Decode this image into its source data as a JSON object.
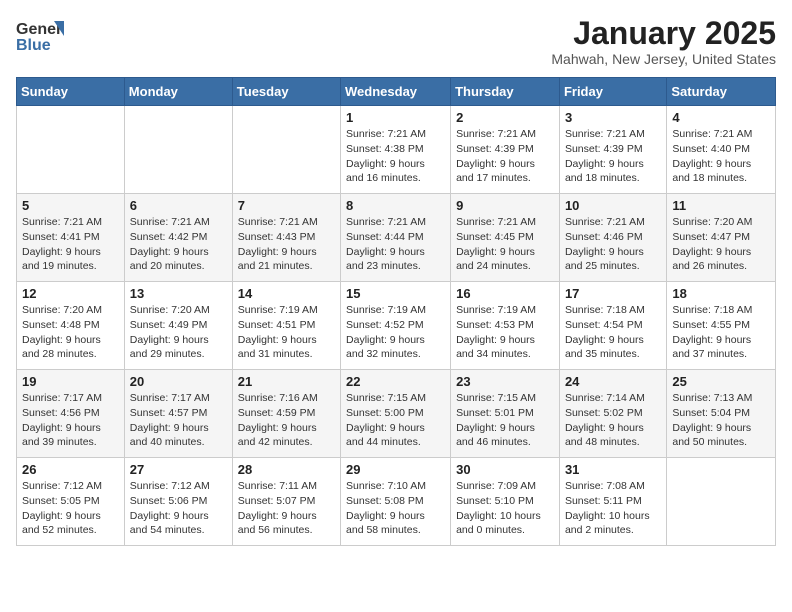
{
  "header": {
    "logo_general": "General",
    "logo_blue": "Blue",
    "month_title": "January 2025",
    "location": "Mahwah, New Jersey, United States"
  },
  "days_of_week": [
    "Sunday",
    "Monday",
    "Tuesday",
    "Wednesday",
    "Thursday",
    "Friday",
    "Saturday"
  ],
  "weeks": [
    [
      {
        "day": "",
        "info": ""
      },
      {
        "day": "",
        "info": ""
      },
      {
        "day": "",
        "info": ""
      },
      {
        "day": "1",
        "info": "Sunrise: 7:21 AM\nSunset: 4:38 PM\nDaylight: 9 hours\nand 16 minutes."
      },
      {
        "day": "2",
        "info": "Sunrise: 7:21 AM\nSunset: 4:39 PM\nDaylight: 9 hours\nand 17 minutes."
      },
      {
        "day": "3",
        "info": "Sunrise: 7:21 AM\nSunset: 4:39 PM\nDaylight: 9 hours\nand 18 minutes."
      },
      {
        "day": "4",
        "info": "Sunrise: 7:21 AM\nSunset: 4:40 PM\nDaylight: 9 hours\nand 18 minutes."
      }
    ],
    [
      {
        "day": "5",
        "info": "Sunrise: 7:21 AM\nSunset: 4:41 PM\nDaylight: 9 hours\nand 19 minutes."
      },
      {
        "day": "6",
        "info": "Sunrise: 7:21 AM\nSunset: 4:42 PM\nDaylight: 9 hours\nand 20 minutes."
      },
      {
        "day": "7",
        "info": "Sunrise: 7:21 AM\nSunset: 4:43 PM\nDaylight: 9 hours\nand 21 minutes."
      },
      {
        "day": "8",
        "info": "Sunrise: 7:21 AM\nSunset: 4:44 PM\nDaylight: 9 hours\nand 23 minutes."
      },
      {
        "day": "9",
        "info": "Sunrise: 7:21 AM\nSunset: 4:45 PM\nDaylight: 9 hours\nand 24 minutes."
      },
      {
        "day": "10",
        "info": "Sunrise: 7:21 AM\nSunset: 4:46 PM\nDaylight: 9 hours\nand 25 minutes."
      },
      {
        "day": "11",
        "info": "Sunrise: 7:20 AM\nSunset: 4:47 PM\nDaylight: 9 hours\nand 26 minutes."
      }
    ],
    [
      {
        "day": "12",
        "info": "Sunrise: 7:20 AM\nSunset: 4:48 PM\nDaylight: 9 hours\nand 28 minutes."
      },
      {
        "day": "13",
        "info": "Sunrise: 7:20 AM\nSunset: 4:49 PM\nDaylight: 9 hours\nand 29 minutes."
      },
      {
        "day": "14",
        "info": "Sunrise: 7:19 AM\nSunset: 4:51 PM\nDaylight: 9 hours\nand 31 minutes."
      },
      {
        "day": "15",
        "info": "Sunrise: 7:19 AM\nSunset: 4:52 PM\nDaylight: 9 hours\nand 32 minutes."
      },
      {
        "day": "16",
        "info": "Sunrise: 7:19 AM\nSunset: 4:53 PM\nDaylight: 9 hours\nand 34 minutes."
      },
      {
        "day": "17",
        "info": "Sunrise: 7:18 AM\nSunset: 4:54 PM\nDaylight: 9 hours\nand 35 minutes."
      },
      {
        "day": "18",
        "info": "Sunrise: 7:18 AM\nSunset: 4:55 PM\nDaylight: 9 hours\nand 37 minutes."
      }
    ],
    [
      {
        "day": "19",
        "info": "Sunrise: 7:17 AM\nSunset: 4:56 PM\nDaylight: 9 hours\nand 39 minutes."
      },
      {
        "day": "20",
        "info": "Sunrise: 7:17 AM\nSunset: 4:57 PM\nDaylight: 9 hours\nand 40 minutes."
      },
      {
        "day": "21",
        "info": "Sunrise: 7:16 AM\nSunset: 4:59 PM\nDaylight: 9 hours\nand 42 minutes."
      },
      {
        "day": "22",
        "info": "Sunrise: 7:15 AM\nSunset: 5:00 PM\nDaylight: 9 hours\nand 44 minutes."
      },
      {
        "day": "23",
        "info": "Sunrise: 7:15 AM\nSunset: 5:01 PM\nDaylight: 9 hours\nand 46 minutes."
      },
      {
        "day": "24",
        "info": "Sunrise: 7:14 AM\nSunset: 5:02 PM\nDaylight: 9 hours\nand 48 minutes."
      },
      {
        "day": "25",
        "info": "Sunrise: 7:13 AM\nSunset: 5:04 PM\nDaylight: 9 hours\nand 50 minutes."
      }
    ],
    [
      {
        "day": "26",
        "info": "Sunrise: 7:12 AM\nSunset: 5:05 PM\nDaylight: 9 hours\nand 52 minutes."
      },
      {
        "day": "27",
        "info": "Sunrise: 7:12 AM\nSunset: 5:06 PM\nDaylight: 9 hours\nand 54 minutes."
      },
      {
        "day": "28",
        "info": "Sunrise: 7:11 AM\nSunset: 5:07 PM\nDaylight: 9 hours\nand 56 minutes."
      },
      {
        "day": "29",
        "info": "Sunrise: 7:10 AM\nSunset: 5:08 PM\nDaylight: 9 hours\nand 58 minutes."
      },
      {
        "day": "30",
        "info": "Sunrise: 7:09 AM\nSunset: 5:10 PM\nDaylight: 10 hours\nand 0 minutes."
      },
      {
        "day": "31",
        "info": "Sunrise: 7:08 AM\nSunset: 5:11 PM\nDaylight: 10 hours\nand 2 minutes."
      },
      {
        "day": "",
        "info": ""
      }
    ]
  ]
}
